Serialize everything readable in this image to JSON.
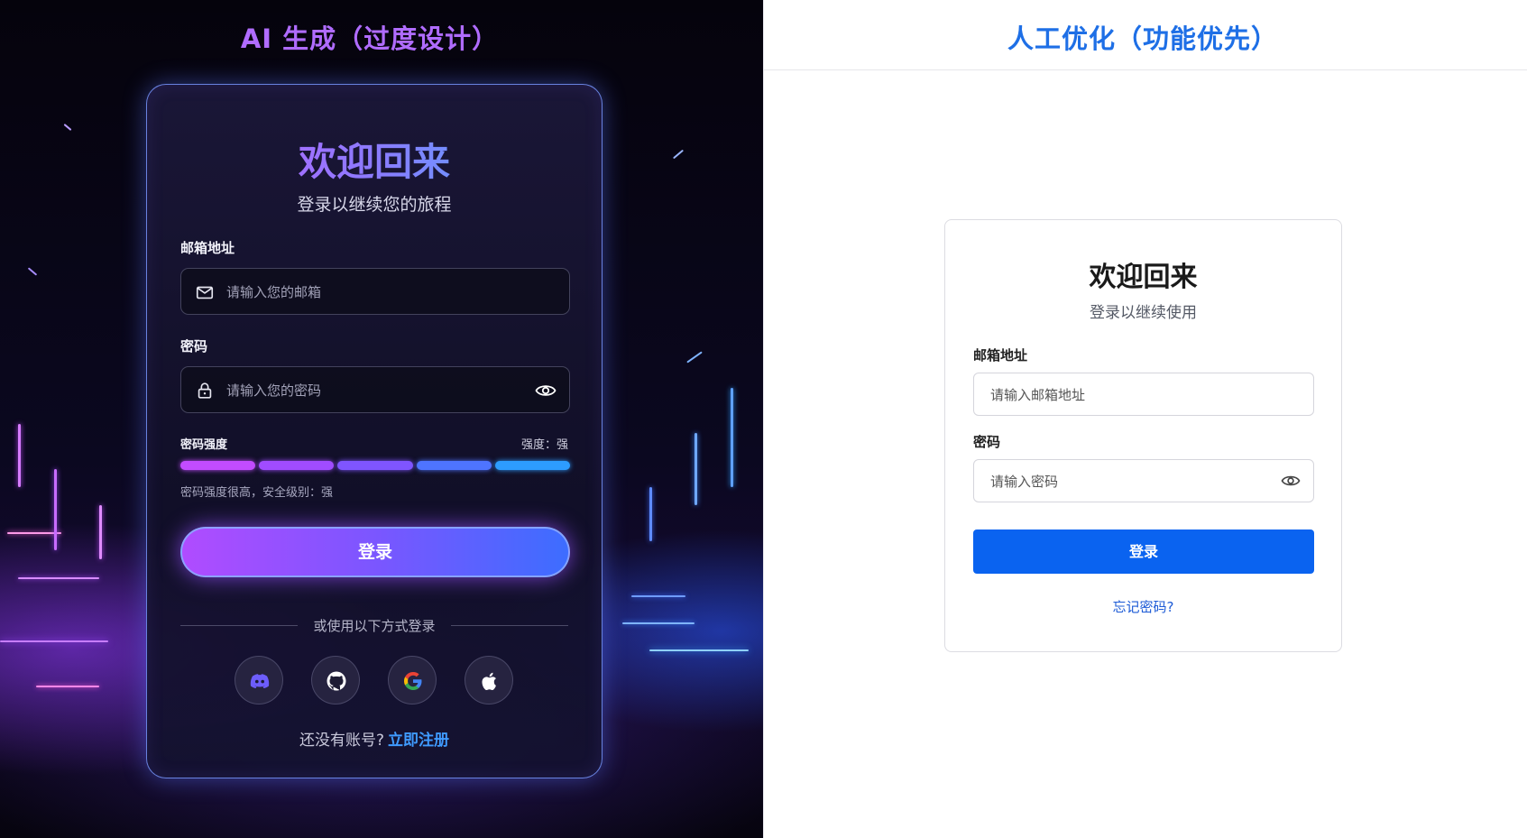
{
  "left_panel": {
    "title": "AI 生成（过度设计）",
    "card": {
      "heading": "欢迎回来",
      "subheading": "登录以继续您的旅程",
      "email": {
        "label": "邮箱地址",
        "placeholder": "请输入您的邮箱",
        "icon": "mail-icon"
      },
      "password": {
        "label": "密码",
        "placeholder": "请输入您的密码",
        "icon": "lock-icon",
        "toggle_icon": "eye-icon"
      },
      "strength": {
        "label": "密码强度",
        "value": "强度：强",
        "level": 1.0,
        "segments": [
          "#c24cff",
          "#a04cff",
          "#7f55ff",
          "#4e74ff",
          "#2d9cff"
        ],
        "note": "密码强度很高，安全级别：强"
      },
      "login_button": "登录",
      "divider_text": "或使用以下方式登录",
      "social_icons": [
        "discord-icon",
        "github-icon",
        "google-icon",
        "apple-icon"
      ],
      "footer_text": "还没有账号?",
      "footer_link": "立即注册"
    }
  },
  "right_panel": {
    "title": "人工优化（功能优先）",
    "card": {
      "heading": "欢迎回来",
      "subheading": "登录以继续使用",
      "email": {
        "label": "邮箱地址",
        "placeholder": "请输入邮箱地址"
      },
      "password": {
        "label": "密码",
        "placeholder": "请输入密码",
        "toggle_icon": "eye-icon"
      },
      "login_button": "登录",
      "forgot_link": "忘记密码?"
    }
  },
  "colors": {
    "left_title": "#b06cff",
    "right_title": "#1e6fe6",
    "primary_button": "#0a63f0",
    "register_link": "#3f9bff"
  }
}
